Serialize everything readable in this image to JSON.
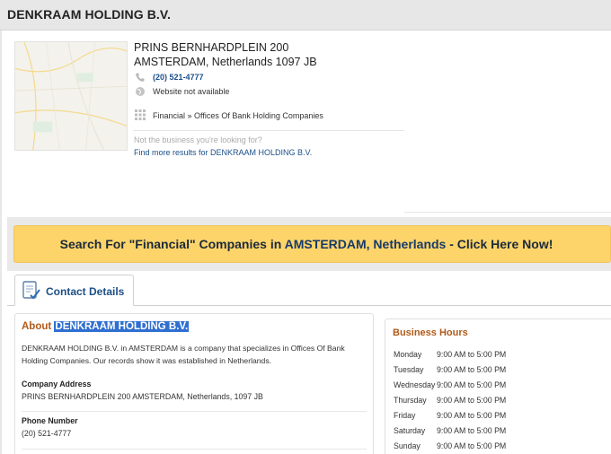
{
  "header": {
    "title": "DENKRAAM HOLDING B.V."
  },
  "business": {
    "address_line1": "PRINS BERNHARDPLEIN 200",
    "address_line2": "AMSTERDAM, Netherlands 1097 JB",
    "phone": "(20) 521-4777",
    "website": "Website not available",
    "category": "Financial » Offices Of Bank Holding Companies",
    "not_business": "Not the business you're looking for?",
    "more_results": "Find more results for DENKRAAM HOLDING B.V.",
    "icons": {
      "phone": "phone-icon",
      "website": "globe-icon",
      "category": "grid-icon"
    }
  },
  "banner": {
    "prefix": "Search For \"Financial\" Companies in ",
    "location": "AMSTERDAM, Netherlands",
    "suffix": " - Click Here Now!"
  },
  "tabs": [
    {
      "label": "Contact Details",
      "icon": "contact-card-icon"
    }
  ],
  "about": {
    "title_prefix": "About ",
    "title_name": "DENKRAAM HOLDING B.V.",
    "description": "DENKRAAM HOLDING B.V. in AMSTERDAM is a company that specializes in Offices Of Bank Holding Companies. Our records show it was established in Netherlands.",
    "company_address_label": "Company Address",
    "company_address": "PRINS BERNHARDPLEIN 200 AMSTERDAM, Netherlands, 1097 JB",
    "phone_label": "Phone Number",
    "phone": "(20) 521-4777"
  },
  "hours": {
    "title": "Business Hours",
    "rows": [
      {
        "day": "Monday",
        "time": "9:00 AM to 5:00 PM"
      },
      {
        "day": "Tuesday",
        "time": "9:00 AM to 5:00 PM"
      },
      {
        "day": "Wednesday",
        "time": "9:00 AM to 5:00 PM"
      },
      {
        "day": "Thursday",
        "time": "9:00 AM to 5:00 PM"
      },
      {
        "day": "Friday",
        "time": "9:00 AM to 5:00 PM"
      },
      {
        "day": "Saturday",
        "time": "9:00 AM to 5:00 PM"
      },
      {
        "day": "Sunday",
        "time": "9:00 AM to 5:00 PM"
      }
    ]
  },
  "colors": {
    "banner_bg": "#fdd46a",
    "accent_link": "#1a4f8a",
    "section_title": "#b05a1a",
    "selection": "#2f6fd0"
  }
}
